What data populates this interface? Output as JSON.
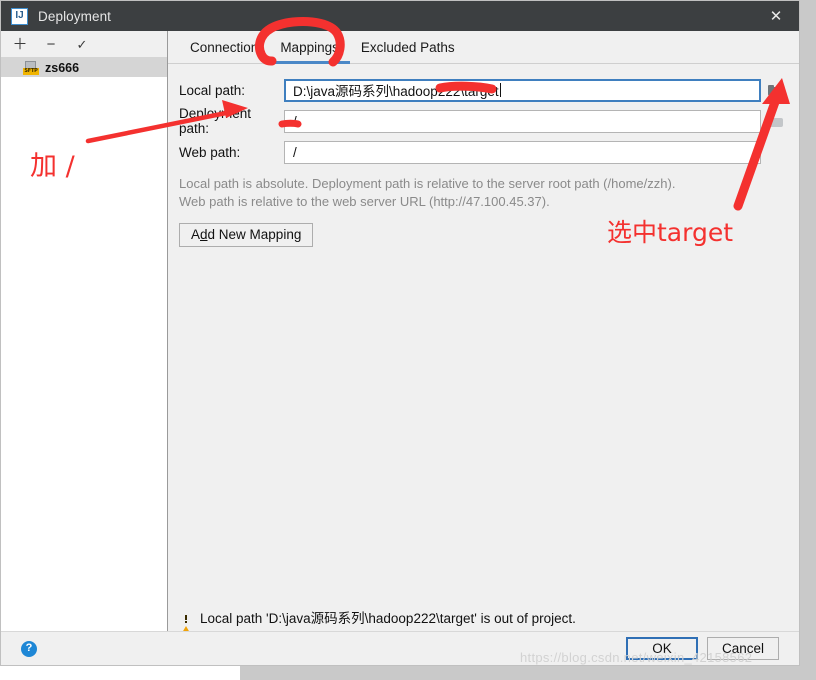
{
  "window": {
    "title": "Deployment",
    "logo_glyph": "IJ",
    "close_glyph": "✕"
  },
  "left_panel": {
    "toolbar": [
      {
        "name": "add",
        "glyph": "＋"
      },
      {
        "name": "remove",
        "glyph": "−"
      },
      {
        "name": "use-as-default",
        "glyph": "✓"
      }
    ],
    "servers": [
      {
        "name": "zs666",
        "icon_label": "SFTP"
      }
    ]
  },
  "tabs": [
    {
      "label": "Connection",
      "active": false
    },
    {
      "label": "Mappings",
      "active": true
    },
    {
      "label": "Excluded Paths",
      "active": false
    }
  ],
  "form": {
    "local_path": {
      "label": "Local path:",
      "value": "D:\\java源码系列\\hadoop222\\target",
      "browse_enabled": true
    },
    "deployment_path": {
      "label": "Deployment path:",
      "value": "/",
      "browse_enabled": false
    },
    "web_path": {
      "label": "Web path:",
      "value": "/",
      "browse_enabled": false
    },
    "hint_line1": "Local path is absolute. Deployment path is relative to the server root path (/home/zzh).",
    "hint_line2": "Web path is relative to the web server URL (http://47.100.45.37).",
    "add_new_mapping": "Add New Mapping",
    "add_new_mapping_mnemonic": "d"
  },
  "warning": {
    "text": "Local path 'D:\\java源码系列\\hadoop222\\target' is out of project."
  },
  "footer": {
    "help_glyph": "?",
    "ok_label": "OK",
    "cancel_label": "Cancel"
  },
  "annotations": {
    "add_slash": "加 /",
    "select_target": "选中target"
  },
  "watermark": {
    "text": "https://blog.csdn.net/weixin_42158562"
  },
  "colors": {
    "titlebar": "#3c3f41",
    "accent_tab": "#4a88c7",
    "annotation_red": "#f4312f",
    "warning_amber": "#f0a30a",
    "focus_blue": "#3f7fbf"
  }
}
